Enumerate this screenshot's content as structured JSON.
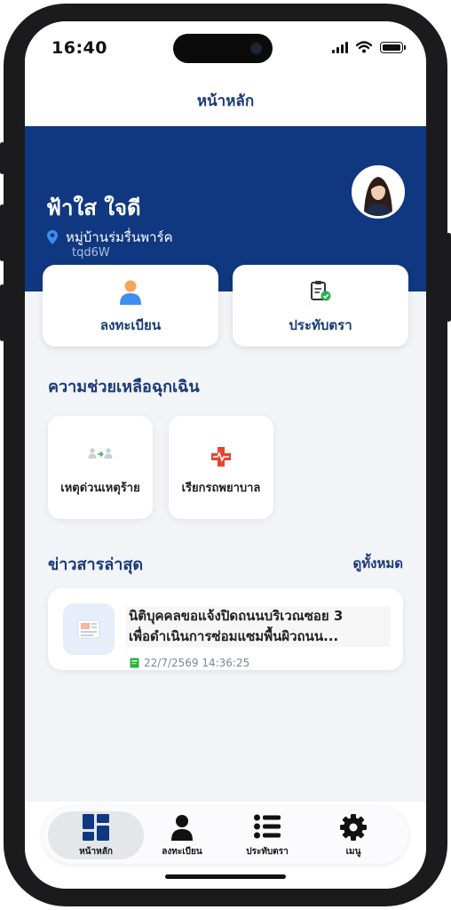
{
  "status_bar": {
    "time": "16:40"
  },
  "header": {
    "title": "หน้าหลัก"
  },
  "profile": {
    "name": "ฟ้าใส ใจดี",
    "village": "หมู่บ้านร่มรื่นพาร์ค",
    "code": "tqd6W",
    "avatar_icon": "user-avatar"
  },
  "quick_actions": [
    {
      "label": "ลงทะเบียน",
      "icon": "person-icon"
    },
    {
      "label": "ประทับตรา",
      "icon": "clipboard-check-icon"
    }
  ],
  "emergency": {
    "title": "ความช่วยเหลือฉุกเฉิน",
    "items": [
      {
        "label": "เหตุด่วนเหตุร้าย",
        "icon": "people-alert-icon"
      },
      {
        "label": "เรียกรถพยาบาล",
        "icon": "medical-cross-icon"
      }
    ]
  },
  "news": {
    "title": "ข่าวสารล่าสุด",
    "see_all": "ดูทั้งหมด",
    "items": [
      {
        "title_line1": "นิติบุคคลขอแจ้งปิดถนนบริเวณซอย 3",
        "title_line2": "เพื่อดำเนินการซ่อมแซมพื้นผิวถนน...",
        "date": "22/7/2569 14:36:25"
      }
    ]
  },
  "tabbar": {
    "active": "home",
    "tabs": [
      {
        "label": "หน้าหลัก",
        "icon": "grid-icon"
      },
      {
        "label": "ลงทะเบียน",
        "icon": "person-icon"
      },
      {
        "label": "ประทับตรา",
        "icon": "list-icon"
      },
      {
        "label": "เมนู",
        "icon": "gear-icon"
      }
    ]
  },
  "colors": {
    "primary": "#0f3880",
    "accent_text": "#1a3a78",
    "background": "#f2f4f8",
    "emergency_red": "#e8432f"
  }
}
